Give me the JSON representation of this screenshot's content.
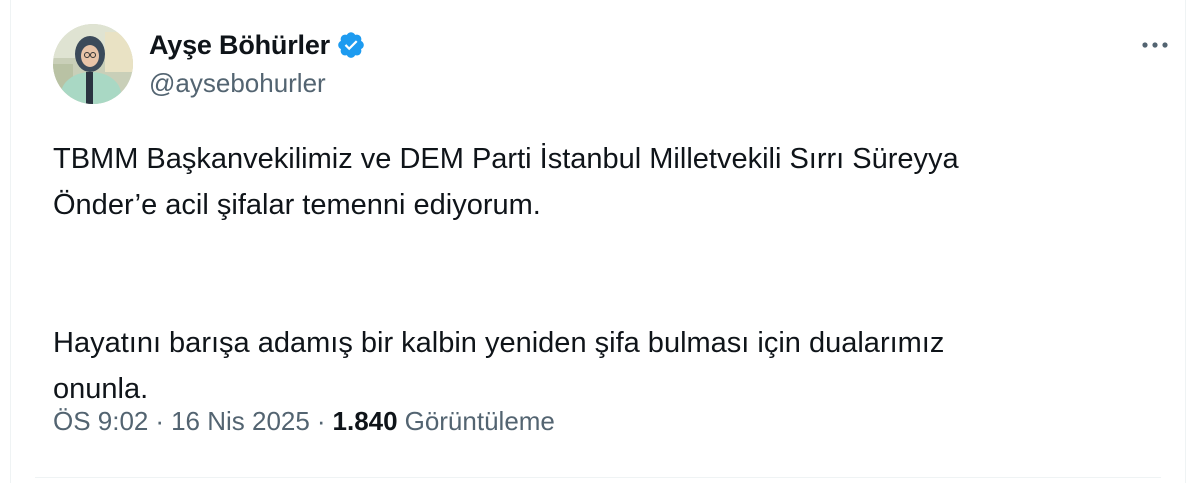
{
  "author": {
    "display_name": "Ayşe Böhürler",
    "handle": "@aysebohurler",
    "verified": true,
    "avatar_icon": "profile-photo-avatar",
    "verified_icon": "blue-verified-badge-icon"
  },
  "more_icon": "more-options-icon",
  "tweet": {
    "paragraph_1": "TBMM Başkanvekilimiz ve DEM Parti İstanbul Milletvekili Sırrı Süreyya\nÖnder’e acil şifalar temenni ediyorum.",
    "paragraph_2": "Hayatını barışa adamış bir kalbin yeniden şifa bulması için dualarımız\nonunla."
  },
  "meta": {
    "time": "ÖS 9:02",
    "separator": "·",
    "date": "16 Nis 2025",
    "views_count": "1.840",
    "views_label": "Görüntüleme"
  },
  "colors": {
    "text_primary": "#0f1419",
    "text_secondary": "#536471",
    "verified_blue": "#1d9bf0",
    "border": "#eff3f4"
  }
}
